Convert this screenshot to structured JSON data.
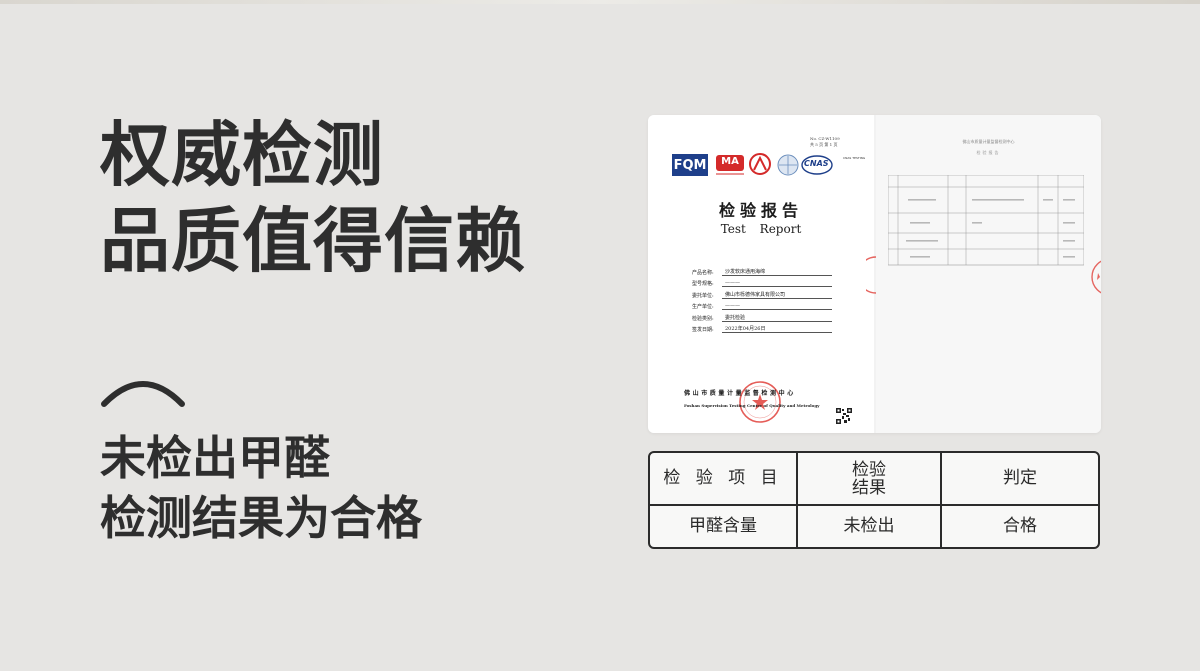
{
  "headline": {
    "line1": "权威检测",
    "line2": "品质值得信赖"
  },
  "result_text": {
    "line1": "未检出甲醛",
    "line2": "检测结果为合格"
  },
  "report": {
    "report_no": "No. CZ-W1109",
    "page_info": "共 5 页 第 1 页",
    "logos": [
      "FQM",
      "MA",
      "CAL",
      "ilac-MRA",
      "CNAS"
    ],
    "testing_label": "CNAS TESTING",
    "title_cn": "检验报告",
    "title_en": "Test Report",
    "fields": [
      {
        "label": "产品名称:",
        "value": "沙发软床通用海绵"
      },
      {
        "label": "型号规格:",
        "value": "———"
      },
      {
        "label": "委托单位:",
        "value": "佛山市栎德伟家具有限公司"
      },
      {
        "label": "生产单位:",
        "value": "———"
      },
      {
        "label": "检验类别:",
        "value": "委托检验"
      },
      {
        "label": "签发日期:",
        "value": "2022年04月26日"
      }
    ],
    "institute_cn": "佛山市质量计量监督检测中心",
    "institute_en": "Foshan Supervision Testing Center of Quality and Metrology",
    "back_title": "佛山市质量计量监督检测中心",
    "back_subtitle": "检验报告"
  },
  "result_table": {
    "headers": {
      "item": "检 验 项 目",
      "result_line1": "检验",
      "result_line2": "结果",
      "judgement": "判定"
    },
    "row": {
      "item": "甲醛含量",
      "result": "未检出",
      "judgement": "合格"
    }
  },
  "colors": {
    "background": "#e6e5e3",
    "text": "#2e2e2e",
    "fqm_blue": "#1e3f8a",
    "ma_red": "#d42a2a",
    "stamp_red": "#e0403a"
  },
  "icons": [
    "chevron-up-icon",
    "fqm-logo",
    "ma-logo",
    "cal-logo",
    "ilac-logo",
    "cnas-logo",
    "official-seal",
    "qr-code"
  ]
}
